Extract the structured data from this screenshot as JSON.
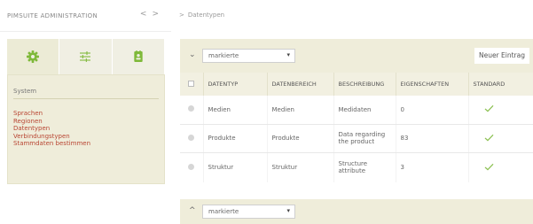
{
  "sidebar": {
    "title": "PIMSUITE ADMINISTRATION",
    "nav_back": "<",
    "nav_forward": ">",
    "tabs": [
      {
        "icon": "gear-icon",
        "active": true
      },
      {
        "icon": "sliders-icon",
        "active": false
      },
      {
        "icon": "contact-card-icon",
        "active": false
      }
    ],
    "section_title": "System",
    "items": [
      "Sprachen",
      "Regionen",
      "Datentypen",
      "Verbindungstypen",
      "Stammdaten bestimmen"
    ]
  },
  "breadcrumb": {
    "separator": ">",
    "current": "Datentypen"
  },
  "toolbar_top": {
    "toggle": "⌄",
    "select_value": "markierte",
    "select_caret": "▾",
    "new_button": "Neuer Eintrag"
  },
  "toolbar_bottom": {
    "toggle": "^",
    "select_value": "markierte",
    "select_caret": "▾"
  },
  "table": {
    "headers": [
      "DATENTYP",
      "DATENBEREICH",
      "BESCHREIBUNG",
      "EIGENSCHAFTEN",
      "STANDARD"
    ],
    "rows": [
      {
        "datentyp": "Medien",
        "datenbereich": "Medien",
        "beschreibung": "Medidaten",
        "eigenschaften": "0",
        "standard": true
      },
      {
        "datentyp": "Produkte",
        "datenbereich": "Produkte",
        "beschreibung": "Data regarding the product",
        "eigenschaften": "83",
        "standard": true
      },
      {
        "datentyp": "Struktur",
        "datenbereich": "Struktur",
        "beschreibung": "Structure attribute",
        "eigenschaften": "3",
        "standard": true
      }
    ]
  },
  "colors": {
    "accent_panel": "#efedda",
    "icon_green": "#7fb93a",
    "link_red": "#b84532",
    "check_green": "#8cc152"
  }
}
